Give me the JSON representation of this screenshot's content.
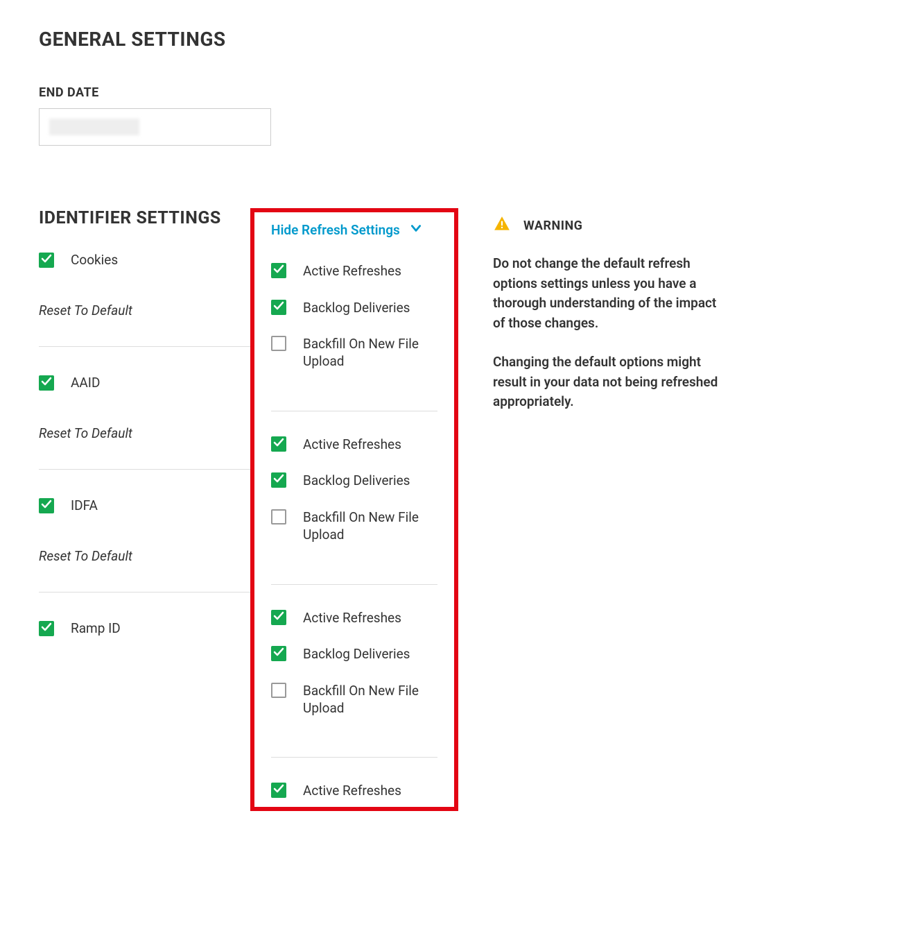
{
  "general_settings": {
    "title": "GENERAL SETTINGS",
    "end_date_label": "END DATE",
    "end_date_value": ""
  },
  "identifier_settings": {
    "title": "IDENTIFIER SETTINGS",
    "toggle_label": "Hide Refresh Settings",
    "reset_label": "Reset To Default",
    "option_labels": {
      "active_refreshes": "Active Refreshes",
      "backlog_deliveries": "Backlog Deliveries",
      "backfill_upload": "Backfill On New File Upload"
    },
    "identifiers": [
      {
        "name": "Cookies",
        "enabled": true,
        "active_refreshes": true,
        "backlog_deliveries": true,
        "backfill_upload": false
      },
      {
        "name": "AAID",
        "enabled": true,
        "active_refreshes": true,
        "backlog_deliveries": true,
        "backfill_upload": false
      },
      {
        "name": "IDFA",
        "enabled": true,
        "active_refreshes": true,
        "backlog_deliveries": true,
        "backfill_upload": false
      },
      {
        "name": "Ramp ID",
        "enabled": true,
        "active_refreshes": true
      }
    ]
  },
  "warning": {
    "title": "WARNING",
    "para1": "Do not change the default refresh options settings unless you have a thorough understanding of the impact of those changes.",
    "para2": "Changing the default options might result in your data not being refreshed appropriately."
  }
}
